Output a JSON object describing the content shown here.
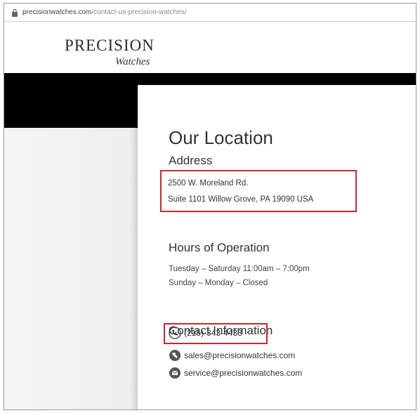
{
  "browser": {
    "url_host": "precisionwatches.com",
    "url_path": "/contact-us-precision-watches/"
  },
  "logo": {
    "main": "PRECISION",
    "sub": "Watches"
  },
  "location": {
    "title": "Our Location",
    "address_heading": "Address",
    "address_line1": "2500 W. Moreland Rd.",
    "address_line2": "Suite 1101 Willow Grove, PA 19090 USA"
  },
  "hours": {
    "heading": "Hours of Operation",
    "line1": "Tuesday – Saturday 11:00am – 7:00pm",
    "line2": "Sunday – Monday – Closed"
  },
  "contact": {
    "heading": "Contact Information",
    "phone": "(215)-343-4433",
    "sales_email": "sales@precisionwatches.com",
    "service_email": "service@precisionwatches.com"
  },
  "colors": {
    "highlight": "#c8282e",
    "header_band": "#000000"
  }
}
